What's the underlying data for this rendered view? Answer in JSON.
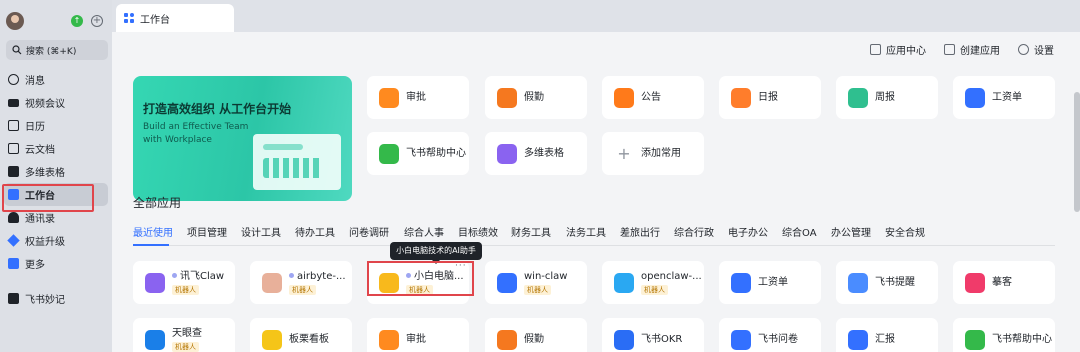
{
  "sidebar": {
    "search_label": "搜索 (⌘+K)",
    "items": [
      {
        "label": "消息",
        "icon": "message-icon",
        "color": "#1f2329"
      },
      {
        "label": "视频会议",
        "icon": "video-icon",
        "color": "#1f2329"
      },
      {
        "label": "日历",
        "icon": "calendar-icon",
        "color": "#1f2329"
      },
      {
        "label": "云文档",
        "icon": "doc-icon",
        "color": "#1f2329"
      },
      {
        "label": "多维表格",
        "icon": "table-icon",
        "color": "#1f2329"
      },
      {
        "label": "工作台",
        "icon": "workplace-icon",
        "color": "#3370ff"
      },
      {
        "label": "通讯录",
        "icon": "contacts-icon",
        "color": "#1f2329"
      },
      {
        "label": "权益升级",
        "icon": "diamond-icon",
        "color": "#3370ff"
      },
      {
        "label": "更多",
        "icon": "more-icon",
        "color": "#1f2329"
      }
    ],
    "bottom_item": {
      "label": "飞书妙记",
      "icon": "minutes-icon"
    }
  },
  "tab": {
    "label": "工作台"
  },
  "header": {
    "app_center": "应用中心",
    "create_app": "创建应用",
    "settings": "设置"
  },
  "banner": {
    "title": "打造高效组织 从工作台开始",
    "subtitle": "Build an Effective Team with Workplace"
  },
  "common_apps": [
    {
      "label": "审批",
      "icon": "approval-icon",
      "color": "#ff8a1f"
    },
    {
      "label": "假勤",
      "icon": "attendance-icon",
      "color": "#f5781f"
    },
    {
      "label": "公告",
      "icon": "announcement-icon",
      "color": "#ff7a1a"
    },
    {
      "label": "日报",
      "icon": "daily-report-icon",
      "color": "#ff7d2b"
    },
    {
      "label": "周报",
      "icon": "weekly-report-icon",
      "color": "#2fbf8f"
    },
    {
      "label": "工资单",
      "icon": "payslip-icon",
      "color": "#3370ff"
    },
    {
      "label": "飞书帮助中心",
      "icon": "help-center-icon",
      "color": "#34b94a"
    },
    {
      "label": "多维表格",
      "icon": "bitable-icon",
      "color": "#8a63f0"
    },
    {
      "label": "添加常用",
      "icon": "add-icon",
      "color": "#8f959e"
    }
  ],
  "all_apps_title": "全部应用",
  "categories": [
    "最近使用",
    "项目管理",
    "设计工具",
    "待办工具",
    "问卷调研",
    "综合人事",
    "目标绩效",
    "财务工具",
    "法务工具",
    "差旅出行",
    "综合行政",
    "电子办公",
    "综合OA",
    "办公管理",
    "安全合规"
  ],
  "robot_badge": "机器人",
  "tooltip": "小白电脑技术的AI助手",
  "recent_row1": [
    {
      "label": "讯飞Claw",
      "badge": true,
      "dot": true,
      "icon": "robot-icon",
      "color": "#8a63f0"
    },
    {
      "label": "airbyte-...",
      "badge": true,
      "dot": true,
      "icon": "avatar-icon",
      "color": "#e8b09a"
    },
    {
      "label": "小白电脑...",
      "badge": true,
      "dot": true,
      "icon": "robot-icon",
      "color": "#f8b91c"
    },
    {
      "label": "win-claw",
      "badge": true,
      "dot": false,
      "icon": "robot-icon",
      "color": "#3370ff"
    },
    {
      "label": "openclaw-...",
      "badge": true,
      "dot": false,
      "icon": "cube-icon",
      "color": "#2aa8f2"
    },
    {
      "label": "工资单",
      "badge": false,
      "dot": false,
      "icon": "payslip-icon",
      "color": "#3370ff"
    },
    {
      "label": "飞书提醒",
      "badge": false,
      "dot": false,
      "icon": "alarm-icon",
      "color": "#4a8cff"
    },
    {
      "label": "摹客",
      "badge": false,
      "dot": false,
      "icon": "mockplus-icon",
      "color": "#f03b6a"
    }
  ],
  "recent_row2": [
    {
      "label": "天眼查",
      "badge": true,
      "icon": "tianyancha-icon",
      "color": "#1a7fe8"
    },
    {
      "label": "板栗看板",
      "badge": false,
      "icon": "board-icon",
      "color": "#f5c518"
    },
    {
      "label": "审批",
      "badge": false,
      "icon": "approval-icon",
      "color": "#ff8a1f"
    },
    {
      "label": "假勤",
      "badge": false,
      "icon": "attendance-icon",
      "color": "#f5781f"
    },
    {
      "label": "飞书OKR",
      "badge": false,
      "icon": "okr-icon",
      "color": "#2a6df5"
    },
    {
      "label": "飞书问卷",
      "badge": false,
      "icon": "survey-icon",
      "color": "#3370ff"
    },
    {
      "label": "汇报",
      "badge": false,
      "icon": "report-icon",
      "color": "#3370ff"
    },
    {
      "label": "飞书帮助中心",
      "badge": false,
      "icon": "help-center-icon",
      "color": "#34b94a"
    }
  ]
}
